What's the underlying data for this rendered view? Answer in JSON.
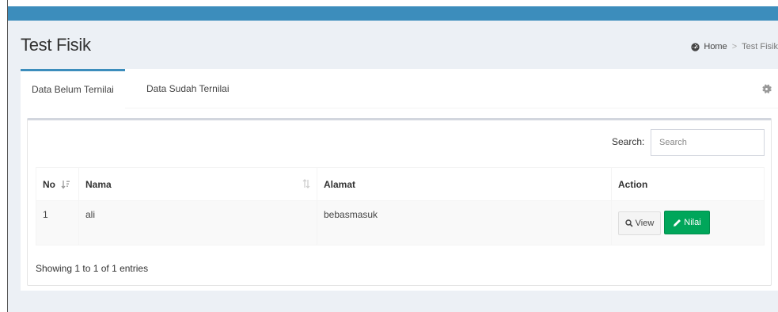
{
  "page": {
    "title": "Test Fisik"
  },
  "breadcrumb": {
    "home": "Home",
    "separator": ">",
    "current": "Test Fisik"
  },
  "tabs": [
    {
      "label": "Data Belum Ternilai",
      "active": true
    },
    {
      "label": "Data Sudah Ternilai",
      "active": false
    }
  ],
  "search": {
    "label": "Search:",
    "placeholder": "Search",
    "value": ""
  },
  "table": {
    "columns": [
      "No",
      "Nama",
      "Alamat",
      "Action"
    ],
    "rows": [
      {
        "no": "1",
        "nama": "ali",
        "alamat": "bebasmasuk"
      }
    ],
    "actions": {
      "view_label": "View",
      "nilai_label": "Nilai"
    }
  },
  "footer": {
    "info": "Showing 1 to 1 of 1 entries"
  },
  "colors": {
    "primary": "#3c8dbc",
    "success": "#00a65a",
    "background": "#ecf0f5"
  },
  "icons": {
    "breadcrumb_home": "dashboard-icon",
    "tab_settings": "gear-icon",
    "view": "search-icon",
    "nilai": "pencil-icon",
    "sort_no": "sort-asc-icon",
    "sort_nama": "sort-icon"
  }
}
